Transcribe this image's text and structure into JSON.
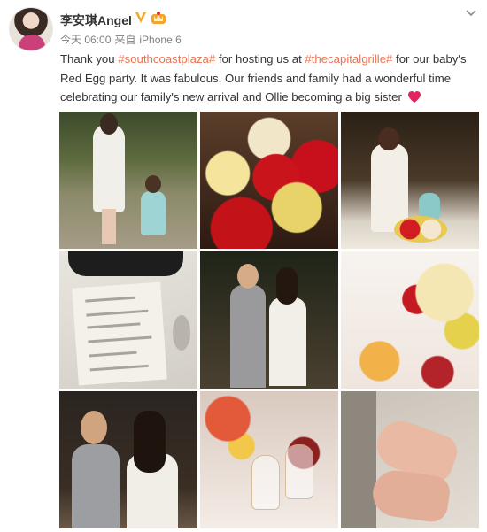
{
  "post": {
    "author": "李安琪Angel",
    "timestamp": "今天 06:00",
    "source_prefix": "来自",
    "source_device": "iPhone 6",
    "text_1": "Thank you ",
    "tag_1": "#southcoastplaza#",
    "text_2": " for hosting us at ",
    "tag_2": "#thecapitalgrille#",
    "text_3": " for our baby's Red Egg party. It was fabulous. Our friends and family had a wonderful time celebrating our family's new arrival and Ollie becoming a big sister",
    "icons": {
      "verified": "verified-v-icon",
      "member": "vip-crown-icon",
      "more": "chevron-down-icon",
      "heart": "red-heart-emoji"
    },
    "colors": {
      "tag": "#eb7350",
      "verified": "#f5a623",
      "heart": "#e0245e"
    }
  },
  "photos": [
    {
      "name": "photo-mother-daughter-garden"
    },
    {
      "name": "photo-red-roses"
    },
    {
      "name": "photo-mother-child-table"
    },
    {
      "name": "photo-menu-sunglasses"
    },
    {
      "name": "photo-couple-toast"
    },
    {
      "name": "photo-flowers-desserts"
    },
    {
      "name": "photo-couple-portrait"
    },
    {
      "name": "photo-champagne-glasses"
    },
    {
      "name": "photo-baby-feet"
    }
  ]
}
